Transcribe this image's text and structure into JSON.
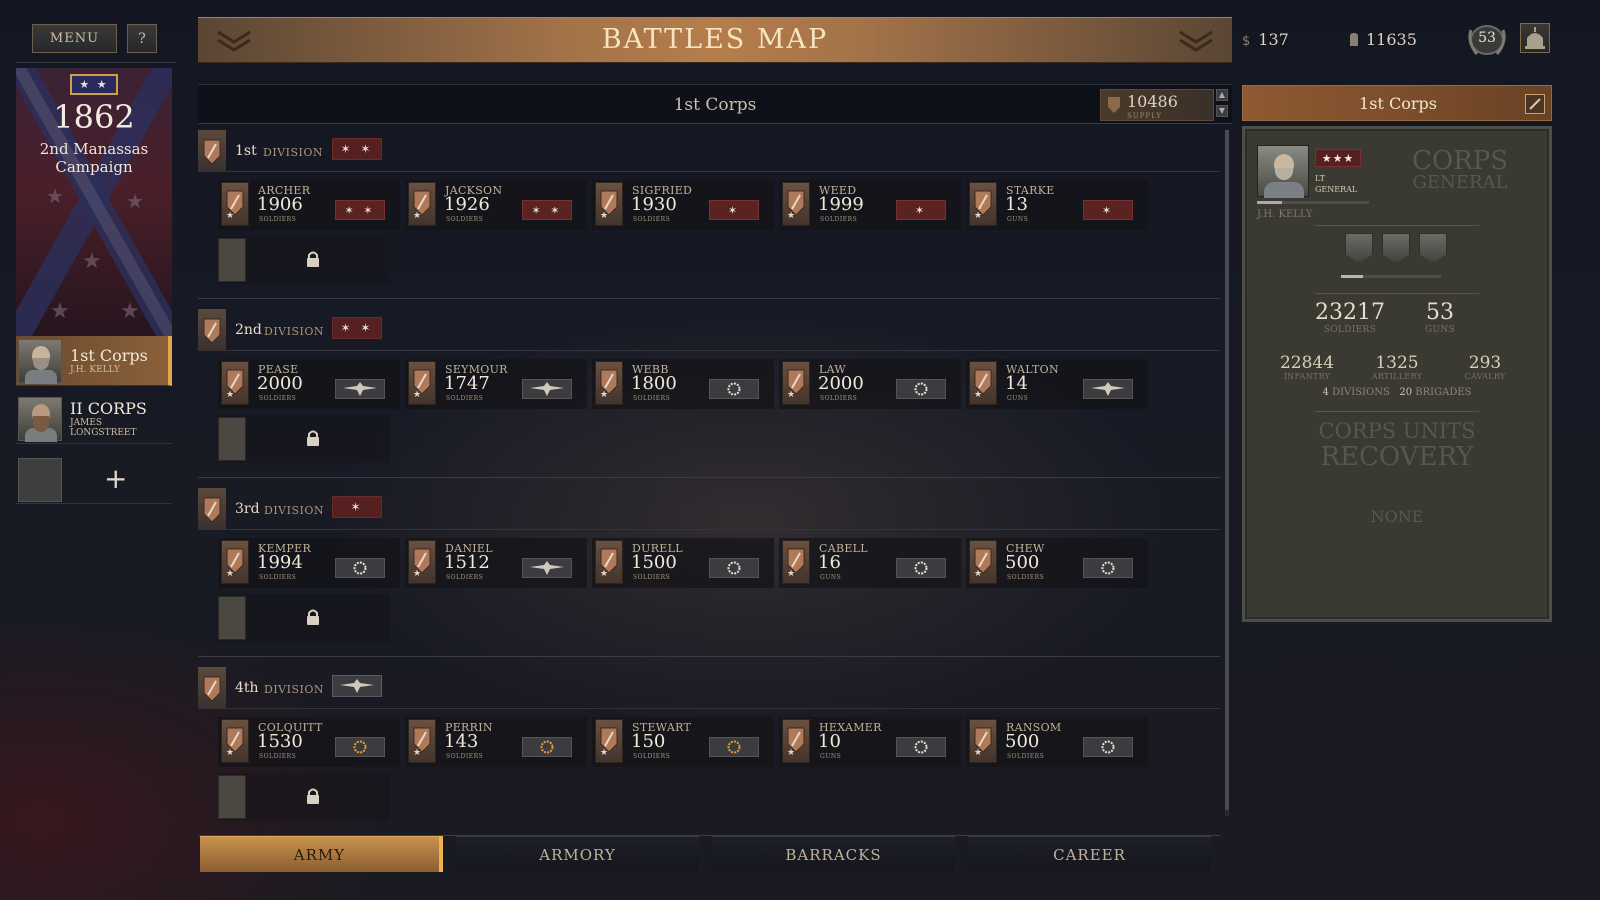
{
  "header": {
    "menu_label": "MENU",
    "help_label": "?",
    "title": "BATTLES MAP",
    "money": "137",
    "money_symbol": "$",
    "manpower": "11635",
    "rank_level": "53"
  },
  "campaign": {
    "badge": "★ ★",
    "year": "1862",
    "name": "2nd Manassas Campaign"
  },
  "corps_list": [
    {
      "name": "1st Corps",
      "general": "J.H. KELLY",
      "selected": true
    },
    {
      "name": "II CORPS",
      "general": "JAMES LONGSTREET",
      "selected": false
    }
  ],
  "add_corps_label": "+",
  "main": {
    "corps_title": "1st Corps",
    "supply_value": "10486",
    "supply_label": "SUPPLY",
    "word_division": "DIVISION",
    "divisions": [
      {
        "name": "1st",
        "rank": "✶ ✶",
        "rank_type": "red",
        "units": [
          {
            "name": "ARCHER",
            "value": "1906",
            "type": "SOLDIERS",
            "exp": "✶ ✶",
            "exp_type": "red"
          },
          {
            "name": "JACKSON",
            "value": "1926",
            "type": "SOLDIERS",
            "exp": "✶ ✶",
            "exp_type": "red"
          },
          {
            "name": "SIGFRIED",
            "value": "1930",
            "type": "SOLDIERS",
            "exp": "✶",
            "exp_type": "red"
          },
          {
            "name": "WEED",
            "value": "1999",
            "type": "SOLDIERS",
            "exp": "✶",
            "exp_type": "red"
          },
          {
            "name": "STARKE",
            "value": "13",
            "type": "GUNS",
            "exp": "✶",
            "exp_type": "red"
          }
        ]
      },
      {
        "name": "2nd",
        "rank": "✶ ✶",
        "rank_type": "red",
        "units": [
          {
            "name": "PEASE",
            "value": "2000",
            "type": "SOLDIERS",
            "exp": "eagle",
            "exp_type": "eagle"
          },
          {
            "name": "SEYMOUR",
            "value": "1747",
            "type": "SOLDIERS",
            "exp": "eagle",
            "exp_type": "eagle"
          },
          {
            "name": "WEBB",
            "value": "1800",
            "type": "SOLDIERS",
            "exp": "wreath",
            "exp_type": "wreath"
          },
          {
            "name": "LAW",
            "value": "2000",
            "type": "SOLDIERS",
            "exp": "wreath",
            "exp_type": "wreath"
          },
          {
            "name": "WALTON",
            "value": "14",
            "type": "GUNS",
            "exp": "eagle",
            "exp_type": "eagle"
          }
        ]
      },
      {
        "name": "3rd",
        "rank": "✶",
        "rank_type": "red",
        "units": [
          {
            "name": "KEMPER",
            "value": "1994",
            "type": "SOLDIERS",
            "exp": "wreath",
            "exp_type": "wreath"
          },
          {
            "name": "DANIEL",
            "value": "1512",
            "type": "SOLDIERS",
            "exp": "eagle",
            "exp_type": "eagle"
          },
          {
            "name": "DURELL",
            "value": "1500",
            "type": "SOLDIERS",
            "exp": "wreath",
            "exp_type": "wreath"
          },
          {
            "name": "CABELL",
            "value": "16",
            "type": "GUNS",
            "exp": "wreath",
            "exp_type": "wreath"
          },
          {
            "name": "CHEW",
            "value": "500",
            "type": "SOLDIERS",
            "exp": "wreath",
            "exp_type": "wreath"
          }
        ]
      },
      {
        "name": "4th",
        "rank": "eagle",
        "rank_type": "eagle",
        "units": [
          {
            "name": "COLQUITT",
            "value": "1530",
            "type": "SOLDIERS",
            "exp": "gold-wreath",
            "exp_type": "gold"
          },
          {
            "name": "PERRIN",
            "value": "143",
            "type": "SOLDIERS",
            "exp": "gold-wreath",
            "exp_type": "gold"
          },
          {
            "name": "STEWART",
            "value": "150",
            "type": "SOLDIERS",
            "exp": "gold-wreath",
            "exp_type": "gold"
          },
          {
            "name": "HEXAMER",
            "value": "10",
            "type": "GUNS",
            "exp": "wreath",
            "exp_type": "wreath"
          },
          {
            "name": "RANSOM",
            "value": "500",
            "type": "SOLDIERS",
            "exp": "wreath",
            "exp_type": "wreath"
          }
        ]
      }
    ]
  },
  "tabs": [
    {
      "label": "ARMY",
      "active": true
    },
    {
      "label": "ARMORY",
      "active": false
    },
    {
      "label": "BARRACKS",
      "active": false
    },
    {
      "label": "CAREER",
      "active": false
    }
  ],
  "right_panel": {
    "corps_title": "1st Corps",
    "general_stars": "★★★",
    "general_rank": "LT GENERAL",
    "general_name": "J.H. KELLY",
    "corps_general_line1": "CORPS",
    "corps_general_line2": "GENERAL",
    "soldiers": "23217",
    "soldiers_label": "SOLDIERS",
    "guns": "53",
    "guns_label": "GUNS",
    "infantry": "22844",
    "infantry_label": "INFANTRY",
    "artillery": "1325",
    "artillery_label": "ARTILLERY",
    "cavalry": "293",
    "cavalry_label": "CAVALRY",
    "divisions_count": "4",
    "divisions_label": "DIVISIONS",
    "brigades_count": "20",
    "brigades_label": "BRIGADES",
    "recovery_line1": "CORPS UNITS",
    "recovery_line2": "RECOVERY",
    "recovery_value": "NONE"
  },
  "colors": {
    "accent_orange": "#b57d4b",
    "rank_red": "#5b2222",
    "gold": "#e0a42a"
  }
}
